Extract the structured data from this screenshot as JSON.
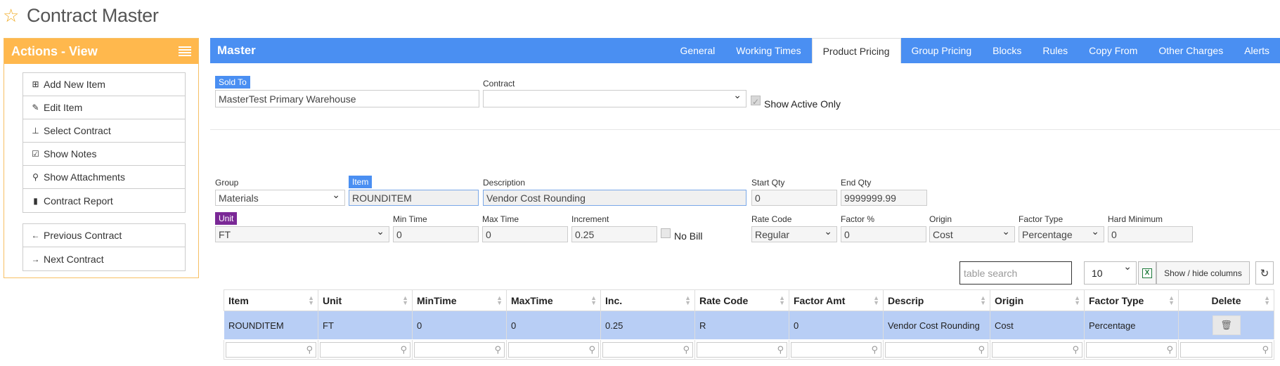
{
  "page": {
    "title": "Contract Master"
  },
  "actions": {
    "title": "Actions - View",
    "group1": [
      {
        "label": "Add New Item",
        "icon": "plus-square-icon"
      },
      {
        "label": "Edit Item",
        "icon": "pencil-icon"
      },
      {
        "label": "Select Contract",
        "icon": "pin-icon"
      },
      {
        "label": "Show Notes",
        "icon": "edit-note-icon"
      },
      {
        "label": "Show Attachments",
        "icon": "paperclip-icon"
      },
      {
        "label": "Contract Report",
        "icon": "file-icon"
      }
    ],
    "group2": [
      {
        "label": "Previous Contract",
        "icon": "arrow-left-icon"
      },
      {
        "label": "Next Contract",
        "icon": "arrow-right-icon"
      }
    ]
  },
  "master": {
    "title": "Master",
    "tabs": [
      "General",
      "Working Times",
      "Product Pricing",
      "Group Pricing",
      "Blocks",
      "Rules",
      "Copy From",
      "Other Charges",
      "Alerts"
    ],
    "active_tab": "Product Pricing"
  },
  "form": {
    "sold_to_label": "Sold To",
    "sold_to_value": "MasterTest Primary Warehouse",
    "contract_label": "Contract",
    "contract_value": "",
    "show_active_label": "Show Active Only",
    "group_label": "Group",
    "group_value": "Materials",
    "item_label": "Item",
    "item_value": "ROUNDITEM",
    "description_label": "Description",
    "description_value": "Vendor Cost Rounding",
    "start_qty_label": "Start Qty",
    "start_qty_value": "0",
    "end_qty_label": "End Qty",
    "end_qty_value": "9999999.99",
    "unit_label": "Unit",
    "unit_value": "FT",
    "min_time_label": "Min Time",
    "min_time_value": "0",
    "max_time_label": "Max Time",
    "max_time_value": "0",
    "increment_label": "Increment",
    "increment_value": "0.25",
    "no_bill_label": "No Bill",
    "rate_code_label": "Rate Code",
    "rate_code_value": "Regular",
    "factor_label": "Factor %",
    "factor_value": "0",
    "origin_label": "Origin",
    "origin_value": "Cost",
    "factor_type_label": "Factor Type",
    "factor_type_value": "Percentage",
    "hard_min_label": "Hard Minimum",
    "hard_min_value": "0"
  },
  "table": {
    "search_placeholder": "table search",
    "page_size": "10",
    "show_hide_label": "Show / hide columns",
    "columns": [
      "Item",
      "Unit",
      "MinTime",
      "MaxTime",
      "Inc.",
      "Rate Code",
      "Factor Amt",
      "Descrip",
      "Origin",
      "Factor Type",
      "Delete"
    ],
    "rows": [
      [
        "ROUNDITEM",
        "FT",
        "0",
        "0",
        "0.25",
        "R",
        "0",
        "Vendor Cost Rounding",
        "Cost",
        "Percentage"
      ]
    ]
  }
}
